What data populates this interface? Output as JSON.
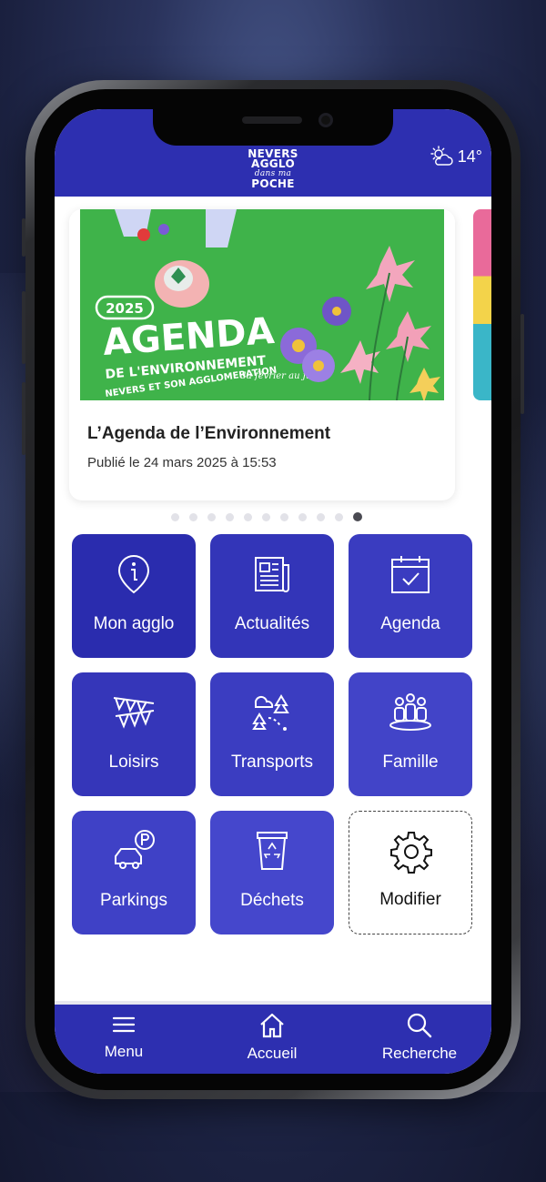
{
  "header": {
    "logo_lines": [
      "NEVERS",
      "AGGLO",
      "dans ma",
      "POCHE"
    ],
    "weather_icon": "partly-cloudy-icon",
    "temperature": "14°"
  },
  "carousel": {
    "image_texts": {
      "year": "2025",
      "title": "AGENDA",
      "subtitle": "DE L'ENVIRONNEMENT",
      "tag": "NEVERS ET SON AGGLOMERATION",
      "dates": "du février au juillet"
    },
    "card_title": "L’Agenda de l’Environnement",
    "card_date": "Publié le 24 mars 2025 à 15:53",
    "page_count": 11,
    "active_index": 10
  },
  "tiles": [
    {
      "label": "Mon agglo",
      "icon": "info-pin-icon",
      "color": "#2a2cae"
    },
    {
      "label": "Actualités",
      "icon": "newspaper-icon",
      "color": "#3335b8"
    },
    {
      "label": "Agenda",
      "icon": "calendar-check-icon",
      "color": "#3a3cc0"
    },
    {
      "label": "Loisirs",
      "icon": "bunting-icon",
      "color": "#3536b9"
    },
    {
      "label": "Transports",
      "icon": "map-route-icon",
      "color": "#3b3dc1"
    },
    {
      "label": "Famille",
      "icon": "people-icon",
      "color": "#4244c8"
    },
    {
      "label": "Parkings",
      "icon": "car-parking-icon",
      "color": "#3f41c6"
    },
    {
      "label": "Déchets",
      "icon": "recycle-bin-icon",
      "color": "#4547cc"
    },
    {
      "label": "Modifier",
      "icon": "gear-icon",
      "color": "#ffffff"
    }
  ],
  "bottom_nav": [
    {
      "label": "Menu",
      "icon": "hamburger-icon"
    },
    {
      "label": "Accueil",
      "icon": "home-icon"
    },
    {
      "label": "Recherche",
      "icon": "search-icon"
    }
  ],
  "colors": {
    "brand": "#2d2fb0",
    "tile_dark": "#2a2cae",
    "tile_light": "#4547cc",
    "image_green": "#3fb34a"
  }
}
